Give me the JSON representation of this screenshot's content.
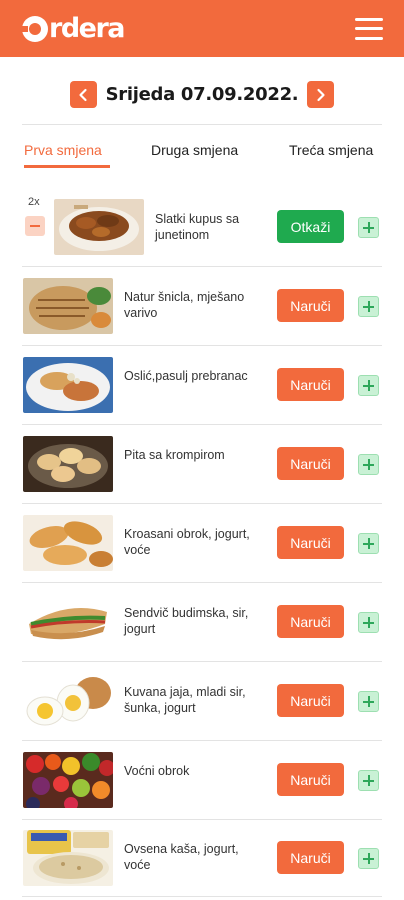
{
  "header": {
    "logo_text": "rdera",
    "brand_color": "#f26a3d",
    "menu_icon": "hamburger-menu-icon"
  },
  "date_nav": {
    "date_label": "Srijeda 07.09.2022.",
    "prev_icon": "chevron-left-icon",
    "next_icon": "chevron-right-icon"
  },
  "tabs": [
    {
      "label": "Prva smjena",
      "active": true
    },
    {
      "label": "Druga smjena",
      "active": false
    },
    {
      "label": "Treća smjena",
      "active": false
    }
  ],
  "items": [
    {
      "name": "Slatki kupus sa junetinom",
      "quantity": "2x",
      "action": "Otkaži",
      "ordered": true
    },
    {
      "name": "Natur šnicla, mješano varivo",
      "action": "Naruči",
      "ordered": false
    },
    {
      "name": "Oslić,pasulj prebranac",
      "action": "Naruči",
      "ordered": false
    },
    {
      "name": "Pita sa krompirom",
      "action": "Naruči",
      "ordered": false
    },
    {
      "name": "Kroasani obrok, jogurt, voće",
      "action": "Naruči",
      "ordered": false
    },
    {
      "name": "Sendvič budimska, sir, jogurt",
      "action": "Naruči",
      "ordered": false
    },
    {
      "name": "Kuvana jaja, mladi sir, šunka, jogurt",
      "action": "Naruči",
      "ordered": false
    },
    {
      "name": "Voćni obrok",
      "action": "Naruči",
      "ordered": false
    },
    {
      "name": "Ovsena kaša, jogurt, voće",
      "action": "Naruči",
      "ordered": false
    }
  ],
  "colors": {
    "order_button": "#f26a3d",
    "cancel_button": "#1faa4f",
    "plus_button": "#c9f1d5"
  }
}
